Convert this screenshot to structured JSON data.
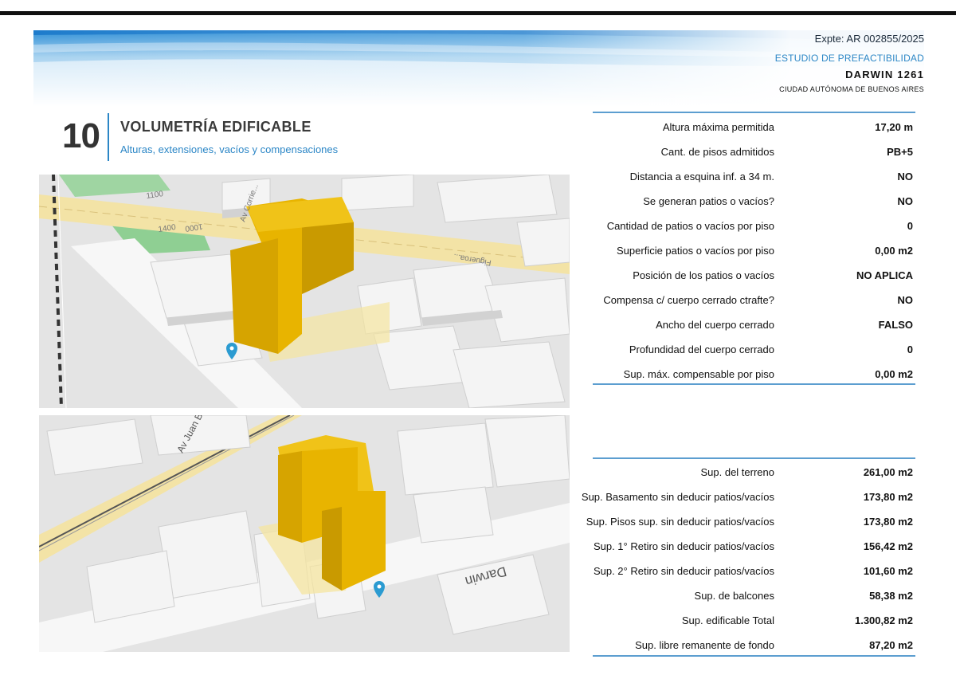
{
  "header": {
    "expte": "Expte: AR 002855/2025",
    "estudio": "ESTUDIO DE PREFACTIBILIDAD",
    "address": "DARWIN  1261",
    "city": "CIUDAD AUTÓNOMA DE BUENOS AIRES"
  },
  "section": {
    "number": "10",
    "title": "VOLUMETRÍA EDIFICABLE",
    "subtitle": "Alturas, extensiones, vacíos y compensaciones"
  },
  "map1": {
    "street_labels": [
      "Av Corrie...",
      "1100",
      "1000",
      "1400",
      "Figueroa..."
    ]
  },
  "map2": {
    "street_labels": [
      "Av Juan B Justo",
      "Darwin"
    ]
  },
  "colors": {
    "accent": "#2b86c6",
    "building": "#e8b400",
    "road": "#f3e3a6"
  },
  "table1": {
    "rows": [
      {
        "label": "Altura máxima permitida",
        "value": "17,20 m"
      },
      {
        "label": "Cant. de pisos admitidos",
        "value": "PB+5"
      },
      {
        "label": "Distancia a esquina inf. a 34 m.",
        "value": "NO"
      },
      {
        "label": "Se generan patios o vacíos?",
        "value": "NO"
      },
      {
        "label": "Cantidad de patios o vacíos por piso",
        "value": "0"
      },
      {
        "label": "Superficie patios o vacíos por piso",
        "value": "0,00 m2"
      },
      {
        "label": "Posición de los patios o vacíos",
        "value": "NO APLICA"
      },
      {
        "label": "Compensa c/ cuerpo cerrado ctrafte?",
        "value": "NO"
      },
      {
        "label": "Ancho del  cuerpo cerrado",
        "value": "FALSO"
      },
      {
        "label": "Profundidad del  cuerpo cerrado",
        "value": "0"
      },
      {
        "label": "Sup. máx. compensable por piso",
        "value": "0,00 m2"
      }
    ]
  },
  "table2": {
    "rows": [
      {
        "label": "Sup. del terreno",
        "value": "261,00 m2"
      },
      {
        "label": "Sup. Basamento sin deducir patios/vacíos",
        "value": "173,80 m2"
      },
      {
        "label": "Sup. Pisos sup. sin deducir patios/vacíos",
        "value": "173,80 m2"
      },
      {
        "label": "Sup. 1° Retiro sin deducir patios/vacíos",
        "value": "156,42 m2"
      },
      {
        "label": "Sup. 2° Retiro sin deducir patios/vacíos",
        "value": "101,60 m2"
      },
      {
        "label": "Sup. de balcones",
        "value": "58,38 m2"
      },
      {
        "label": "Sup. edificable Total",
        "value": "1.300,82 m2"
      },
      {
        "label": "Sup. libre remanente de fondo",
        "value": "87,20 m2"
      }
    ]
  }
}
